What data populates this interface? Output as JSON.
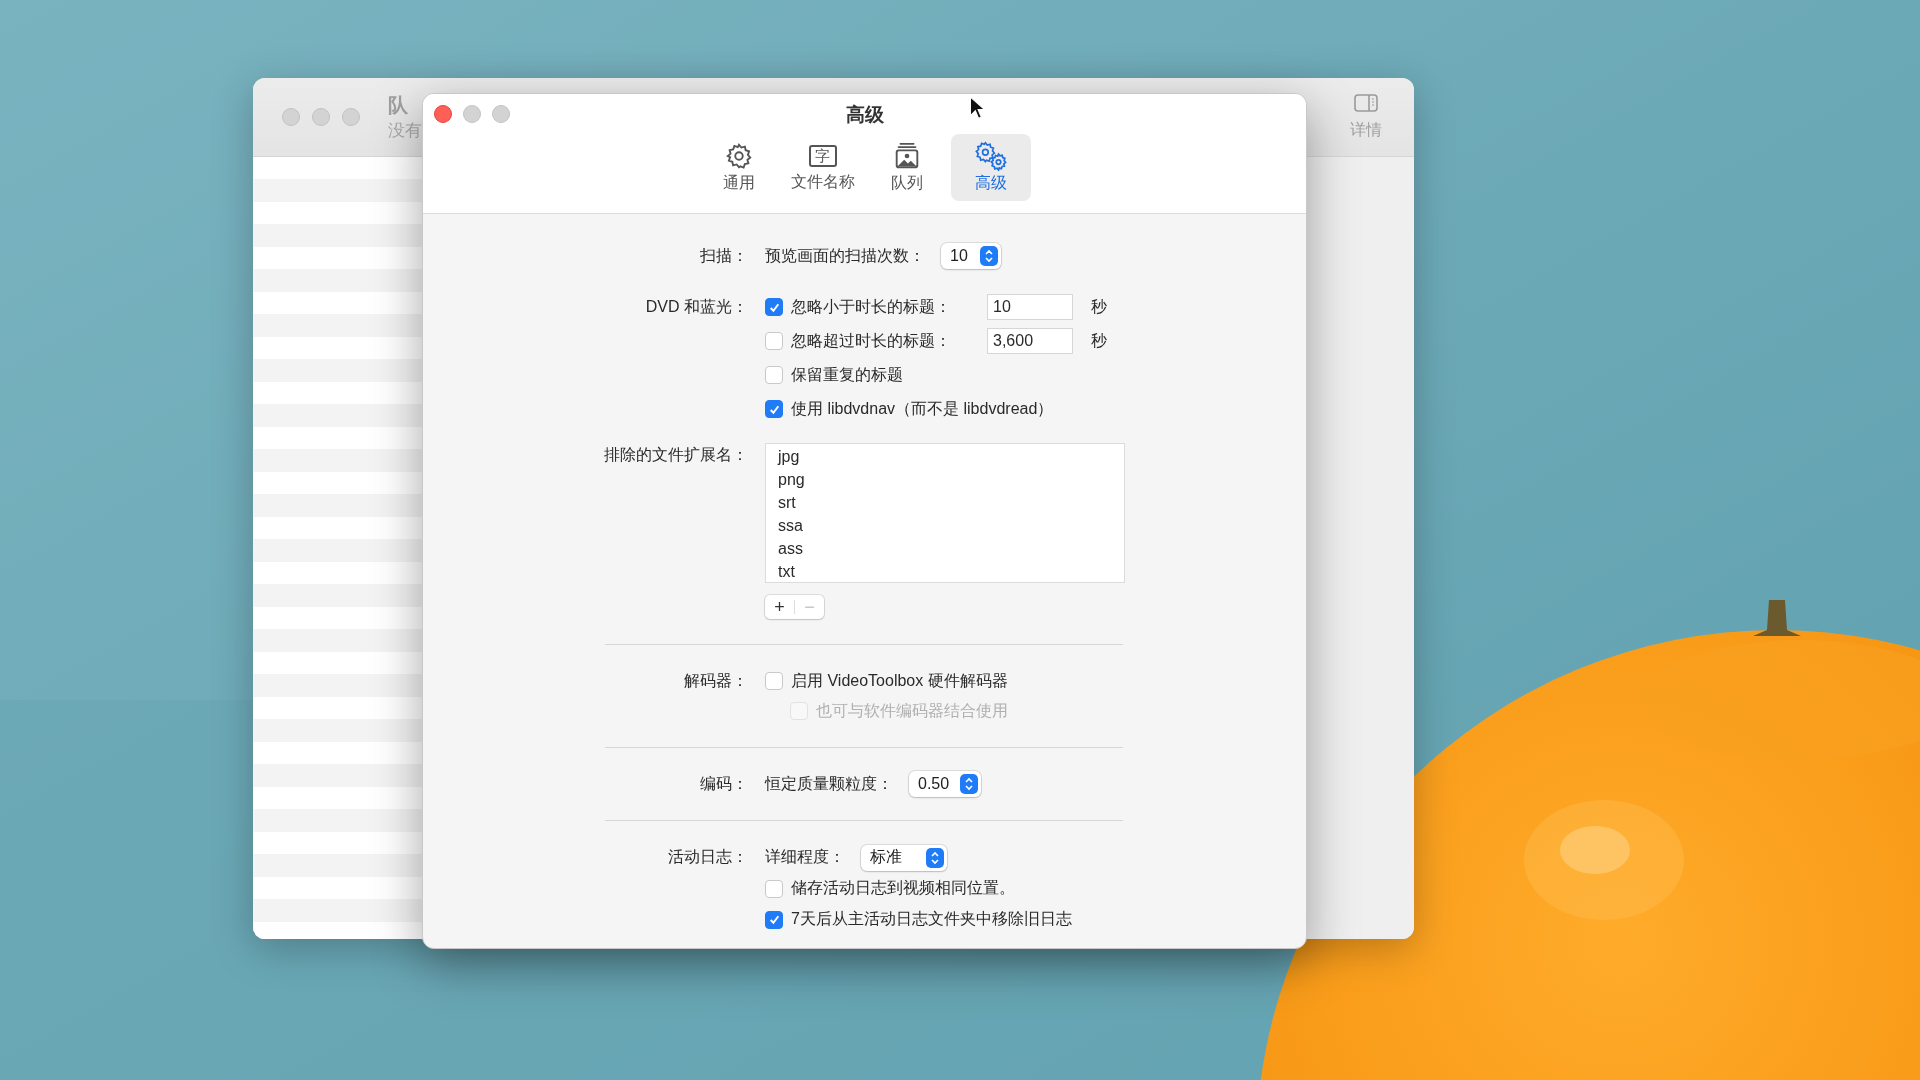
{
  "background_window": {
    "title": "队",
    "subtitle": "没有",
    "details_label": "详情"
  },
  "window": {
    "title": "高级"
  },
  "tabs": [
    {
      "label": "通用",
      "kind": "gear",
      "selected": false
    },
    {
      "label": "文件名称",
      "kind": "glyph",
      "glyph": "字",
      "selected": false
    },
    {
      "label": "队列",
      "kind": "photos",
      "selected": false
    },
    {
      "label": "高级",
      "kind": "gears",
      "selected": true
    }
  ],
  "scan": {
    "label": "扫描：",
    "field_label": "预览画面的扫描次数：",
    "value": "10"
  },
  "dvd": {
    "label": "DVD 和蓝光：",
    "options": [
      {
        "label": "忽略小于时长的标题：",
        "checked": true,
        "value": "10",
        "unit": "秒"
      },
      {
        "label": "忽略超过时长的标题：",
        "checked": false,
        "value": "3,600",
        "unit": "秒"
      },
      {
        "label": "保留重复的标题",
        "checked": false
      },
      {
        "label": "使用 libdvdnav（而不是 libdvdread）",
        "checked": true
      }
    ]
  },
  "excluded_extensions": {
    "label": "排除的文件扩展名：",
    "items": [
      "jpg",
      "png",
      "srt",
      "ssa",
      "ass",
      "txt"
    ],
    "buttons": [
      {
        "label": "+",
        "disabled": false
      },
      {
        "label": "−",
        "disabled": true
      }
    ]
  },
  "decoder": {
    "label": "解码器：",
    "options": [
      {
        "label": "启用 VideoToolbox 硬件解码器",
        "checked": false,
        "disabled": false,
        "children": [
          {
            "label": "也可与软件编码器结合使用",
            "checked": false,
            "disabled": true
          }
        ]
      }
    ]
  },
  "encoding": {
    "label": "编码：",
    "field_label": "恒定质量颗粒度：",
    "value": "0.50"
  },
  "activity_log": {
    "label": "活动日志：",
    "field_label": "详细程度：",
    "value": "标准",
    "options": [
      {
        "label": "储存活动日志到视频相同位置。",
        "checked": false
      },
      {
        "label": "7天后从主活动日志文件夹中移除旧日志",
        "checked": true
      }
    ]
  }
}
